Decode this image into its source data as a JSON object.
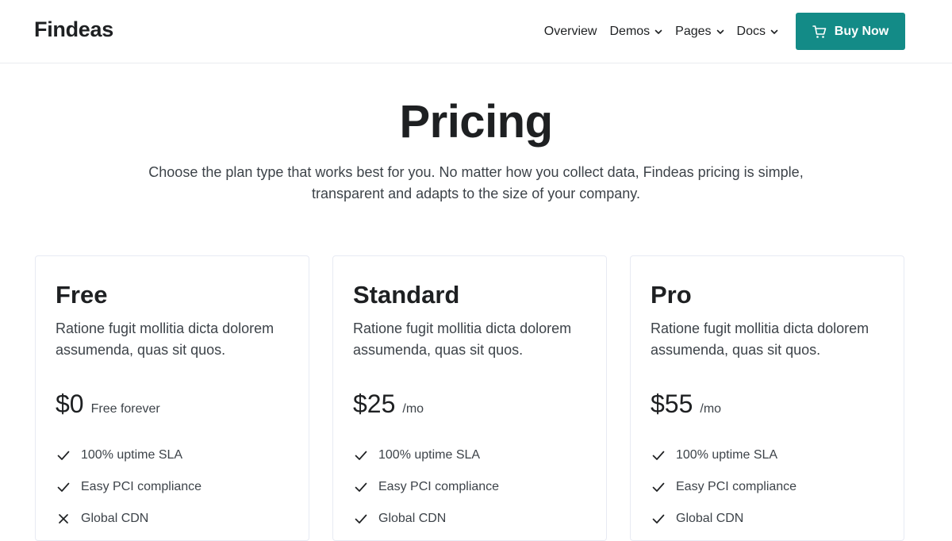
{
  "brand": "Findeas",
  "nav": {
    "links": [
      {
        "label": "Overview",
        "dropdown": false
      },
      {
        "label": "Demos",
        "dropdown": true
      },
      {
        "label": "Pages",
        "dropdown": true
      },
      {
        "label": "Docs",
        "dropdown": true
      }
    ],
    "buy_label": "Buy Now",
    "accent": "#138b87"
  },
  "hero": {
    "title": "Pricing",
    "subtitle": "Choose the plan type that works best for you. No matter how you collect data, Findeas pricing is simple, transparent and adapts to the size of your company."
  },
  "plans": [
    {
      "name": "Free",
      "description": "Ratione fugit mollitia dicta dolorem assumenda, quas sit quos.",
      "price": "$0",
      "unit": "Free forever",
      "features": [
        {
          "label": "100% uptime SLA",
          "icon": "check-icon"
        },
        {
          "label": "Easy PCI compliance",
          "icon": "check-icon"
        },
        {
          "label": "Global CDN",
          "icon": "x-icon"
        }
      ]
    },
    {
      "name": "Standard",
      "description": "Ratione fugit mollitia dicta dolorem assumenda, quas sit quos.",
      "price": "$25",
      "unit": "/mo",
      "features": [
        {
          "label": "100% uptime SLA",
          "icon": "check-icon"
        },
        {
          "label": "Easy PCI compliance",
          "icon": "check-icon"
        },
        {
          "label": "Global CDN",
          "icon": "check-icon"
        }
      ]
    },
    {
      "name": "Pro",
      "description": "Ratione fugit mollitia dicta dolorem assumenda, quas sit quos.",
      "price": "$55",
      "unit": "/mo",
      "features": [
        {
          "label": "100% uptime SLA",
          "icon": "check-icon"
        },
        {
          "label": "Easy PCI compliance",
          "icon": "check-icon"
        },
        {
          "label": "Global CDN",
          "icon": "check-icon"
        }
      ]
    }
  ]
}
